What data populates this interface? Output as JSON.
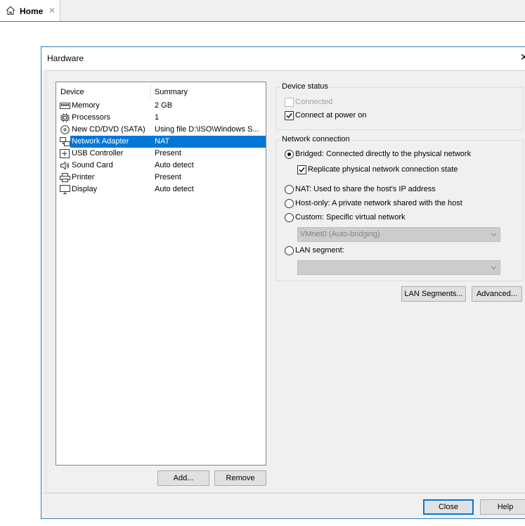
{
  "tab": {
    "label": "Home"
  },
  "dialog": {
    "title": "Hardware"
  },
  "device_list": {
    "columns": [
      "Device",
      "Summary"
    ],
    "rows": [
      {
        "icon": "memory-icon",
        "name": "Memory",
        "summary": "2 GB"
      },
      {
        "icon": "processor-icon",
        "name": "Processors",
        "summary": "1"
      },
      {
        "icon": "cd-dvd-icon",
        "name": "New CD/DVD (SATA)",
        "summary": "Using file D:\\ISO\\Windows S..."
      },
      {
        "icon": "network-adapter-icon",
        "name": "Network Adapter",
        "summary": "NAT",
        "selected": true
      },
      {
        "icon": "usb-icon",
        "name": "USB Controller",
        "summary": "Present"
      },
      {
        "icon": "speaker-icon",
        "name": "Sound Card",
        "summary": "Auto detect"
      },
      {
        "icon": "printer-icon",
        "name": "Printer",
        "summary": "Present"
      },
      {
        "icon": "monitor-icon",
        "name": "Display",
        "summary": "Auto detect"
      }
    ]
  },
  "buttons": {
    "add": "Add...",
    "remove": "Remove",
    "lan_segments": "LAN Segments...",
    "advanced": "Advanced...",
    "close": "Close",
    "help": "Help"
  },
  "device_status": {
    "title": "Device status",
    "connected": {
      "label": "Connected",
      "checked": false,
      "disabled": true
    },
    "connect_at_power_on": {
      "label": "Connect at power on",
      "checked": true
    }
  },
  "network_connection": {
    "title": "Network connection",
    "bridged": "Bridged: Connected directly to the physical network",
    "replicate": "Replicate physical network connection state",
    "nat": "NAT: Used to share the host's IP address",
    "host_only": "Host-only: A private network shared with the host",
    "custom": "Custom: Specific virtual network",
    "custom_select_value": "VMnet0 (Auto-bridging)",
    "lan_segment": "LAN segment:",
    "lan_segment_select_value": "",
    "selected": "bridged"
  },
  "colors": {
    "accent": "#0078d7",
    "border": "#3c7fb1"
  }
}
